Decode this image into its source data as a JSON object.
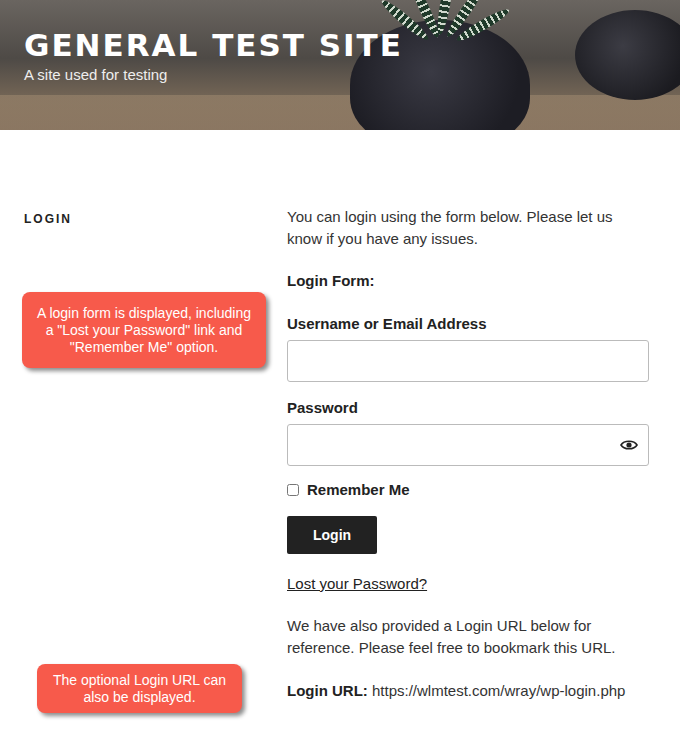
{
  "site": {
    "title": "GENERAL TEST SITE",
    "tagline": "A site used for testing"
  },
  "sidebar": {
    "heading": "LOGIN"
  },
  "content": {
    "intro": "You can login using the form below. Please let us know if you have any issues.",
    "form_heading": "Login Form:",
    "username_label": "Username or Email Address",
    "password_label": "Password",
    "remember_label": "Remember Me",
    "remember_checked": false,
    "login_button": "Login",
    "lost_password": "Lost your Password?",
    "url_intro": "We have also provided a Login URL below for reference. Please feel free to bookmark this URL.",
    "url_label": "Login URL:",
    "url": "https://wlmtest.com/wray/wp-login.php"
  },
  "callouts": [
    {
      "text": "A login form is displayed, including a \"Lost your Password\" link and \"Remember Me\" option."
    },
    {
      "text": "The optional Login URL can also be displayed."
    }
  ]
}
